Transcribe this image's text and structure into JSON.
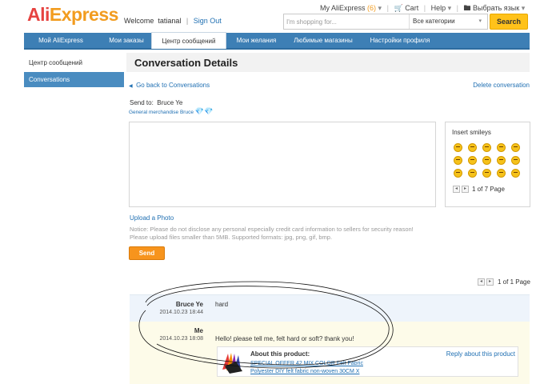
{
  "header": {
    "logo_part1": "Ali",
    "logo_part2": "Express",
    "welcome": "Welcome",
    "username": "tatianal",
    "sign_out": "Sign Out",
    "my_aliexpress": "My AliExpress",
    "my_aliexpress_count": "(6)",
    "cart": "Cart",
    "help": "Help",
    "language": "Выбрать язык",
    "search_placeholder": "I'm shopping for...",
    "category": "Все категории",
    "search_button": "Search"
  },
  "nav": {
    "items": [
      "Мой AliExpress",
      "Мои заказы",
      "Центр сообщений",
      "Мои желания",
      "Любимые магазины",
      "Настройки профиля"
    ],
    "active_index": 2
  },
  "sidebar": {
    "title": "Центр сообщений",
    "active_item": "Conversations"
  },
  "main": {
    "title": "Conversation Details",
    "back_link": "Go back to Conversations",
    "delete_link": "Delete conversation",
    "send_to_label": "Send to:",
    "send_to_name": "Bruce Ye",
    "store_name": "General merchandise Bruce",
    "message_value": "",
    "upload_link": "Upload a Photo",
    "notice": "Notice: Please do not disclose any personal especially credit card information to sellers for security reason! Please upload files smaller than 5MB. Supported formats: jpg, png, gif, bmp.",
    "send_button": "Send"
  },
  "smileys": {
    "title": "Insert smileys",
    "page_text": "1 of 7 Page",
    "count": 15
  },
  "conversation": {
    "page_text": "1 of 1 Page",
    "messages": [
      {
        "sender": "Bruce Ye",
        "date": "2014.10.23 18:44",
        "text": "hard"
      },
      {
        "sender": "Me",
        "date": "2014.10.23 18:08",
        "text": "Hello! please tell me, felt hard or soft? thank you!"
      }
    ],
    "product": {
      "heading": "About this product:",
      "name": "SPECIAL OFFER 42 MIX COLOR Felt Fabric Polyester DIY felt fabric non-woven 30CM X",
      "reply_link": "Reply about this product"
    }
  },
  "colors": {
    "nav_blue": "#3d7fb5",
    "link_blue": "#1f6fb2",
    "send_orange": "#f7941d",
    "search_yellow": "#ffc21a"
  }
}
